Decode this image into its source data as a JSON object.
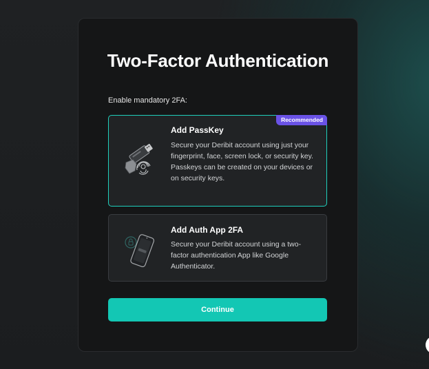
{
  "modal": {
    "title": "Two-Factor Authentication",
    "subtitle": "Enable mandatory 2FA:"
  },
  "options": [
    {
      "title": "Add PassKey",
      "description": "Secure your Deribit account using just your fingerprint, face, screen lock, or security key. Passkeys can be created on your devices or on security keys.",
      "badge": "Recommended",
      "icon": "passkey-icon",
      "selected": true
    },
    {
      "title": "Add Auth App 2FA",
      "description": "Secure your Deribit account using a two-factor authentication App like Google Authenticator.",
      "icon": "phone-auth-icon",
      "selected": false
    }
  ],
  "continue_label": "Continue",
  "colors": {
    "accent": "#13c7b4",
    "selected_border": "#1fd1bd",
    "badge": "#6a52e6",
    "modal_bg": "#151617",
    "card_bg": "#212325"
  }
}
